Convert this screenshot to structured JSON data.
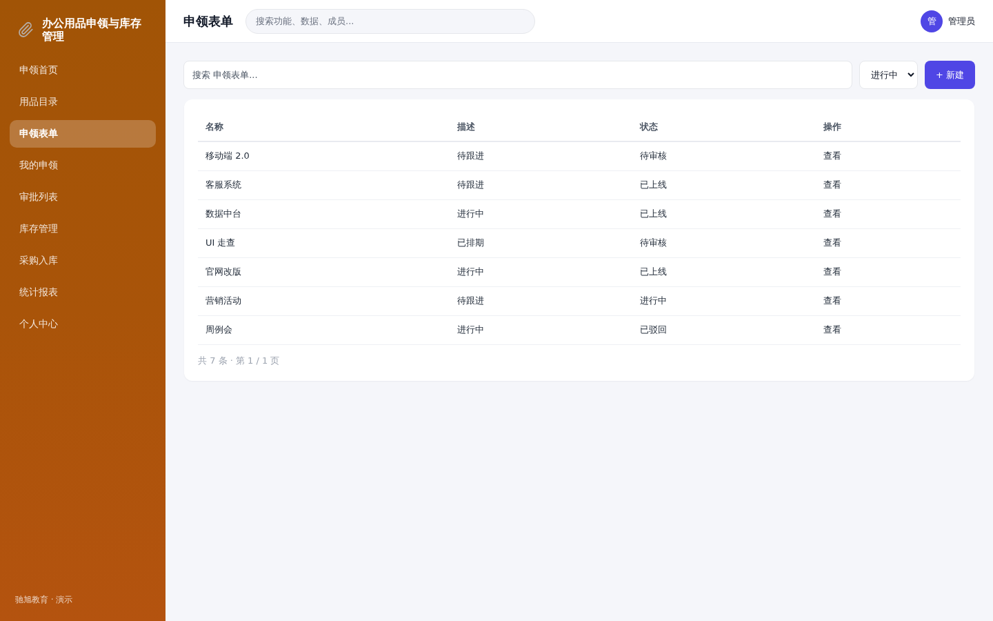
{
  "sidebar": {
    "brand": "办公用品申领与库存管理",
    "items": [
      {
        "label": "申领首页",
        "selected": false
      },
      {
        "label": "用品目录",
        "selected": false
      },
      {
        "label": "申领表单",
        "selected": true
      },
      {
        "label": "我的申领",
        "selected": false
      },
      {
        "label": "审批列表",
        "selected": false
      },
      {
        "label": "库存管理",
        "selected": false
      },
      {
        "label": "采购入库",
        "selected": false
      },
      {
        "label": "统计报表",
        "selected": false
      },
      {
        "label": "个人中心",
        "selected": false
      }
    ],
    "footer": "驰旭教育 · 演示"
  },
  "header": {
    "title": "申领表单",
    "search": {
      "placeholder": "搜索功能、数据、成员..."
    },
    "user": {
      "avatar": "管",
      "name": "管理员"
    }
  },
  "toolbar": {
    "search": {
      "placeholder": "搜索 申领表单..."
    },
    "filter": {
      "value": "进行中"
    },
    "new_button": "+ 新建"
  },
  "table": {
    "columns": [
      "名称",
      "描述",
      "状态",
      "操作"
    ],
    "rows": [
      {
        "name": "移动端 2.0",
        "description": "待跟进",
        "status": "待审核",
        "action": "查看"
      },
      {
        "name": "客服系统",
        "description": "待跟进",
        "status": "已上线",
        "action": "查看"
      },
      {
        "name": "数据中台",
        "description": "进行中",
        "status": "已上线",
        "action": "查看"
      },
      {
        "name": "UI 走查",
        "description": "已排期",
        "status": "待审核",
        "action": "查看"
      },
      {
        "name": "官网改版",
        "description": "进行中",
        "status": "已上线",
        "action": "查看"
      },
      {
        "name": "营销活动",
        "description": "待跟进",
        "status": "进行中",
        "action": "查看"
      },
      {
        "name": "周例会",
        "description": "进行中",
        "status": "已驳回",
        "action": "查看"
      }
    ],
    "pagination": "共 7 条 · 第 1 / 1 页"
  }
}
